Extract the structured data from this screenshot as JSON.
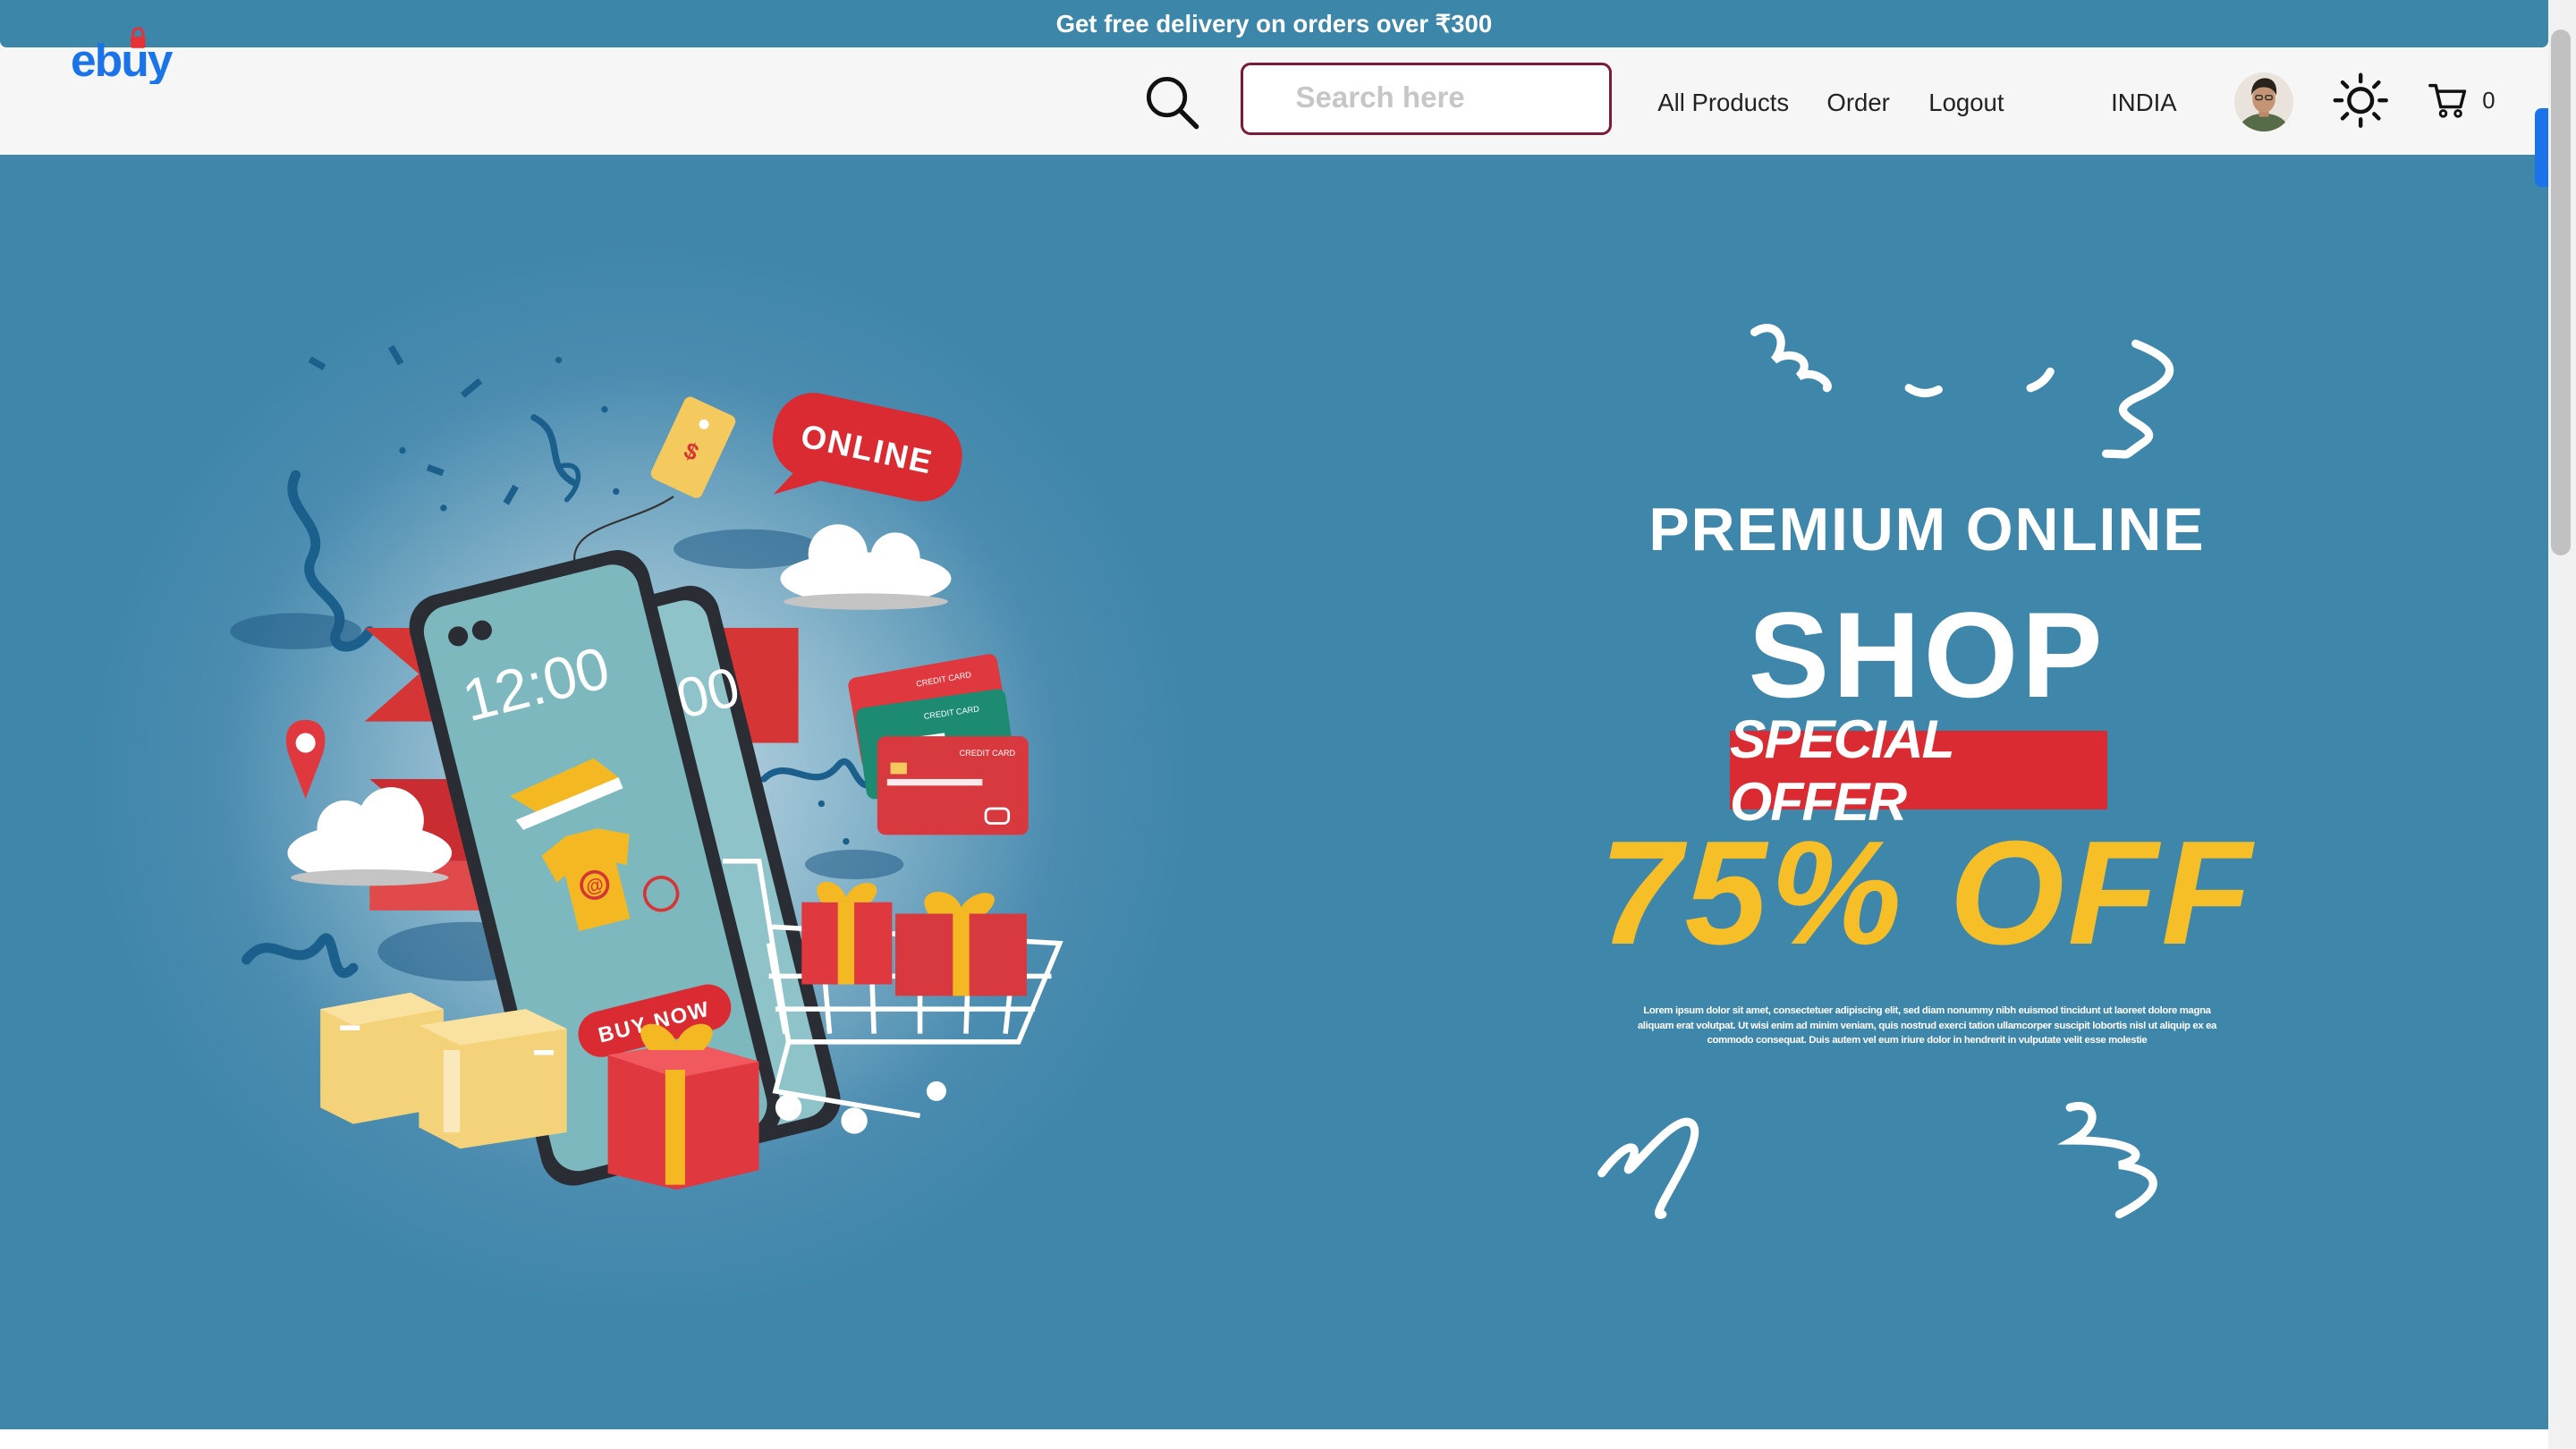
{
  "promo": {
    "text": "Get free delivery on orders over ₹300"
  },
  "header": {
    "logo_text": "ebuy",
    "search": {
      "placeholder": "Search here",
      "value": ""
    },
    "nav": {
      "all_products": "All Products",
      "order": "Order",
      "logout": "Logout"
    },
    "country": "INDIA",
    "cart_count": "0",
    "icons": [
      "search-icon",
      "avatar",
      "sun-icon",
      "cart-icon"
    ]
  },
  "hero": {
    "headline_line1": "PREMIUM ONLINE",
    "headline_line2": "SHOP",
    "special_offer": "SPECIAL OFFER",
    "discount": "75% OFF",
    "lorem": "Lorem ipsum dolor sit amet, consectetuer adipiscing elit, sed diam nonummy nibh euismod tincidunt ut laoreet dolore magna aliquam erat volutpat. Ut wisi enim ad minim veniam, quis nostrud exerci tation ullamcorper suscipit lobortis nisl ut aliquip ex ea commodo consequat. Duis autem vel eum iriure dolor in hendrerit in vulputate velit esse molestie",
    "illustration_labels": {
      "phone_time": "12:00",
      "online_bubble": "ONLINE",
      "buy_now": "BUY NOW",
      "credit_card": "CREDIT CARD",
      "shirt_symbol": "@",
      "tag_symbol": "$"
    }
  },
  "colors": {
    "promo_bar": "#3c86aa",
    "hero_blue": "#3f86ab",
    "accent_red": "#da2b33",
    "accent_yellow": "#f6be27",
    "search_border": "#7b1b3a",
    "logo_blue": "#1a73e8"
  }
}
